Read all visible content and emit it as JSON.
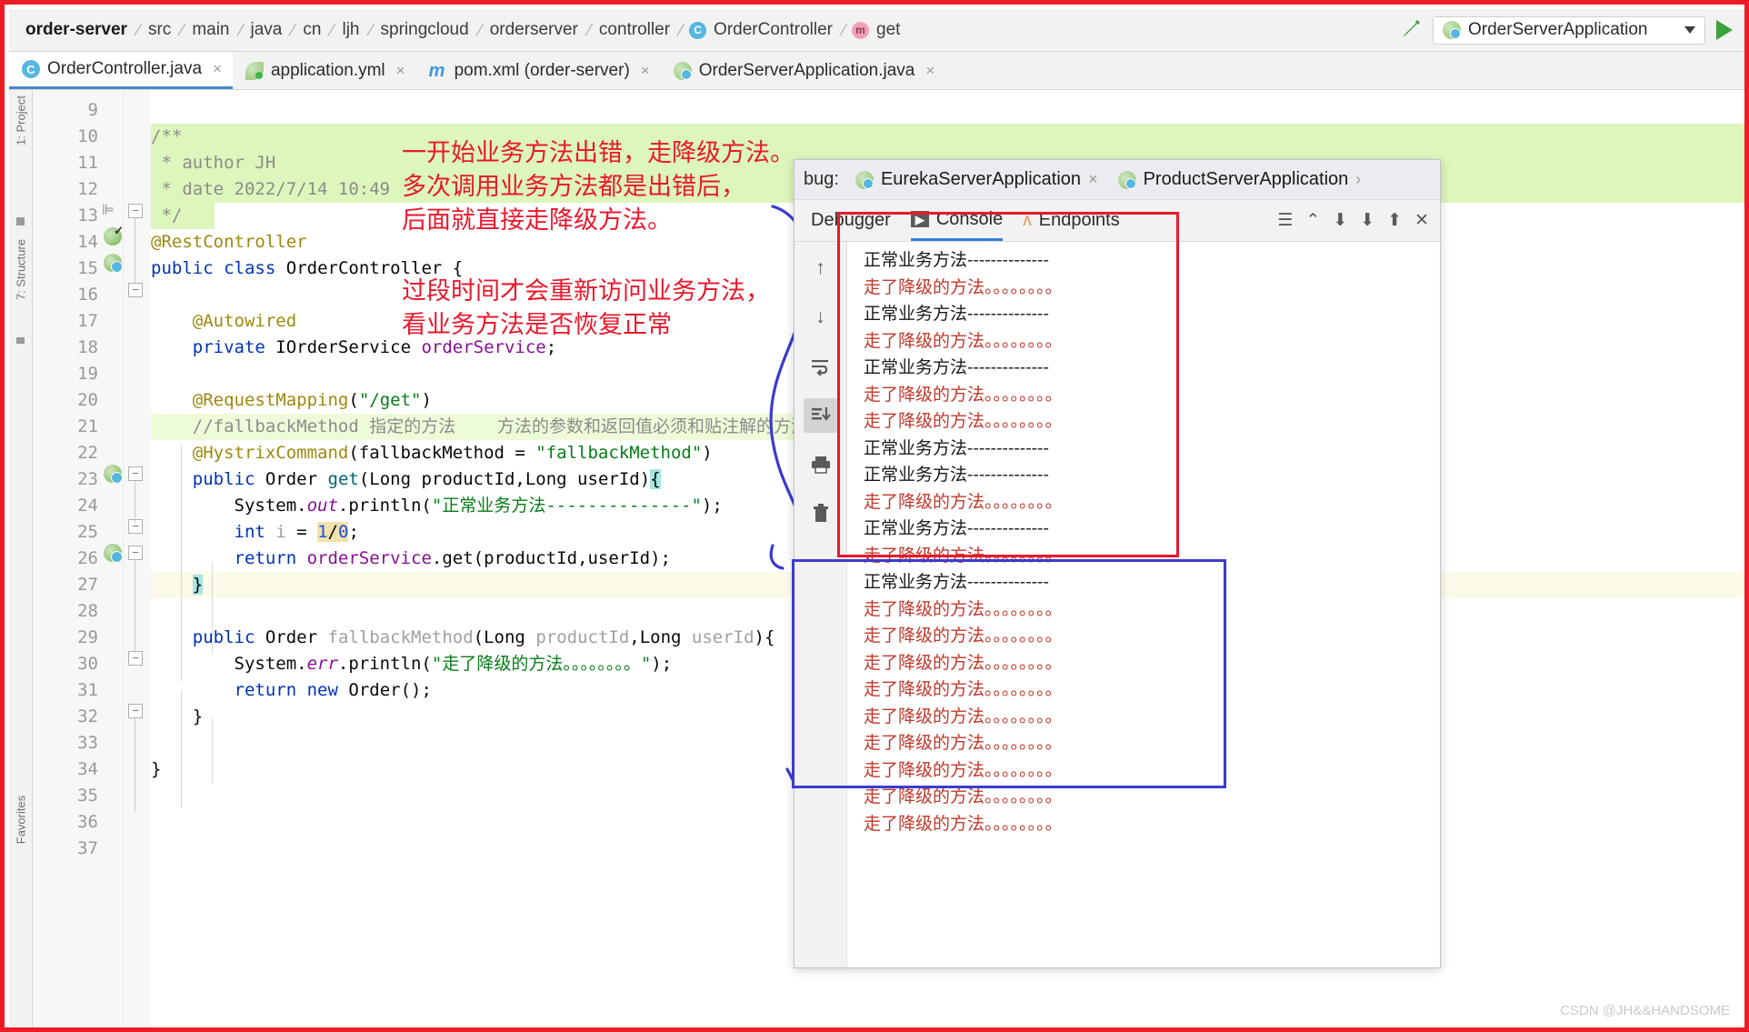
{
  "window": {
    "frame_color": "#ee1c25"
  },
  "breadcrumb": {
    "items": [
      {
        "label": "order-server",
        "bold": true,
        "icon": null
      },
      {
        "label": "src",
        "bold": false,
        "icon": null
      },
      {
        "label": "main",
        "bold": false,
        "icon": null
      },
      {
        "label": "java",
        "bold": false,
        "icon": null
      },
      {
        "label": "cn",
        "bold": false,
        "icon": null
      },
      {
        "label": "ljh",
        "bold": false,
        "icon": null
      },
      {
        "label": "springcloud",
        "bold": false,
        "icon": null
      },
      {
        "label": "orderserver",
        "bold": false,
        "icon": null
      },
      {
        "label": "controller",
        "bold": false,
        "icon": null
      },
      {
        "label": "OrderController",
        "bold": false,
        "icon": "class-badge-c"
      },
      {
        "label": "get",
        "bold": false,
        "icon": "method-badge-m"
      }
    ]
  },
  "toolbar": {
    "hammer_icon": "build-hammer-icon",
    "run_config": "OrderServerApplication",
    "run_config_icon": "springboot-icon",
    "dropdown_icon": "chevron-down-icon",
    "run_icon": "run-play-icon"
  },
  "editor_tabs": [
    {
      "label": "OrderController.java",
      "icon": "java-class-icon",
      "active": true,
      "close": "×"
    },
    {
      "label": "application.yml",
      "icon": "yaml-leaf-icon",
      "active": false,
      "close": "×"
    },
    {
      "label": "pom.xml (order-server)",
      "icon": "maven-m-icon",
      "active": false,
      "close": "×"
    },
    {
      "label": "OrderServerApplication.java",
      "icon": "springboot-icon",
      "active": false,
      "close": "×"
    }
  ],
  "left_rail": {
    "labels": [
      "1: Project",
      "7: Structure",
      "Favorites"
    ]
  },
  "code": {
    "first_line_number": 9,
    "lines": [
      {
        "n": 9,
        "html": "",
        "bg": ""
      },
      {
        "n": 10,
        "html": "<span class='cmt'>/**</span>",
        "bg": "hl-green"
      },
      {
        "n": 11,
        "html": "<span class='cmt'> * author JH</span>",
        "bg": "hl-green"
      },
      {
        "n": 12,
        "html": "<span class='cmt'> * date 2022/7/14 10:49</span>",
        "bg": "hl-green"
      },
      {
        "n": 13,
        "html": "<span class='cmt'> */</span>",
        "bg": "hl-green-partial"
      },
      {
        "n": 14,
        "html": "<span class='anno'>@RestController</span>",
        "bg": ""
      },
      {
        "n": 15,
        "html": "<span class='kw'>public</span> <span class='kw'>class</span> <span class='plain'>OrderController</span> <span class='plain'>{</span>",
        "bg": ""
      },
      {
        "n": 16,
        "html": "",
        "bg": ""
      },
      {
        "n": 17,
        "html": "    <span class='anno'>@Autowired</span>",
        "bg": ""
      },
      {
        "n": 18,
        "html": "    <span class='kw'>private</span> <span class='plain'>IOrderService</span> <span class='fld'>orderService</span><span class='plain'>;</span>",
        "bg": ""
      },
      {
        "n": 19,
        "html": "",
        "bg": ""
      },
      {
        "n": 20,
        "html": "    <span class='anno'>@RequestMapping</span><span class='plain'>(</span><span class='str'>\"/get\"</span><span class='plain'>)</span>",
        "bg": ""
      },
      {
        "n": 21,
        "html": "    <span class='cmt'>//fallbackMethod 指定的方法    方法的参数和返回值必须和贴注解的方法保持一致</span>",
        "bg": "hl-green-soft"
      },
      {
        "n": 22,
        "html": "    <span class='anno'>@HystrixCommand</span><span class='plain'>(fallbackMethod = </span><span class='str'>\"fallbackMethod\"</span><span class='plain'>)</span>",
        "bg": ""
      },
      {
        "n": 23,
        "html": "    <span class='kw'>public</span> <span class='plain'>Order</span> <span class='mth'>get</span><span class='plain'>(Long productId,Long userId)</span><span class='brace-match'>{</span>",
        "bg": ""
      },
      {
        "n": 24,
        "html": "        <span class='plain'>System.</span><span class='stat-italic'>out</span><span class='plain'>.println(</span><span class='str'>\"正常业务方法--------------\"</span><span class='plain'>);</span>",
        "bg": ""
      },
      {
        "n": 25,
        "html": "        <span class='kw'>int</span> <span class='grey'>i</span> <span class='plain'>= </span><span class='warn-hl'><span class='num'>1</span><span class='plain'>/</span><span class='num'>0</span></span><span class='plain'>;</span>",
        "bg": ""
      },
      {
        "n": 26,
        "html": "        <span class='kw'>return</span> <span class='fld'>orderService</span><span class='plain'>.get(productId,userId);</span>",
        "bg": ""
      },
      {
        "n": 27,
        "html": "    <span class='brace-match'>}</span>",
        "bg": "hl-caret"
      },
      {
        "n": 28,
        "html": "",
        "bg": ""
      },
      {
        "n": 29,
        "html": "    <span class='kw'>public</span> <span class='plain'>Order</span> <span class='grey'>fallbackMethod</span><span class='plain'>(Long </span><span class='grey'>productId</span><span class='plain'>,Long </span><span class='grey'>userId</span><span class='plain'>){</span>",
        "bg": ""
      },
      {
        "n": 30,
        "html": "        <span class='plain'>System.</span><span class='stat-italic'>err</span><span class='plain'>.println(</span><span class='str'>\"走了降级的方法。。。。。。。。\"</span><span class='plain'>);</span>",
        "bg": ""
      },
      {
        "n": 31,
        "html": "        <span class='kw'>return</span> <span class='kw'>new</span> <span class='plain'>Order();</span>",
        "bg": ""
      },
      {
        "n": 32,
        "html": "    <span class='plain'>}</span>",
        "bg": ""
      },
      {
        "n": 33,
        "html": "",
        "bg": ""
      },
      {
        "n": 34,
        "html": "<span class='plain'>}</span>",
        "bg": ""
      },
      {
        "n": 35,
        "html": "",
        "bg": ""
      },
      {
        "n": 36,
        "html": "",
        "bg": ""
      },
      {
        "n": 37,
        "html": "",
        "bg": ""
      }
    ]
  },
  "annotations": {
    "color": "#e8192c",
    "block1": [
      "一开始业务方法出错，走降级方法。",
      "多次调用业务方法都是出错后，",
      "后面就直接走降级方法。"
    ],
    "block2": [
      "过段时间才会重新访问业务方法，",
      "看业务方法是否恢复正常"
    ]
  },
  "debug_window": {
    "title": "bug:",
    "app_tabs": [
      {
        "label": "EurekaServerApplication",
        "icon": "springboot-icon",
        "close": "×"
      },
      {
        "label": "ProductServerApplication",
        "icon": "springboot-icon",
        "close": "›"
      }
    ],
    "tabs": [
      {
        "label": "Debugger",
        "icon": null,
        "active": false
      },
      {
        "label": "Console",
        "icon": "console-icon",
        "active": true
      },
      {
        "label": "Endpoints",
        "icon": "endpoints-icon",
        "active": false
      }
    ],
    "tool_icons": [
      "menu-icon",
      "export-icon",
      "download-icon",
      "download-all-icon",
      "upload-icon",
      "close-icon"
    ],
    "side_buttons": [
      {
        "icon": "arrow-up-icon",
        "name": "previous-occurrence",
        "selected": false
      },
      {
        "icon": "arrow-down-icon",
        "name": "next-occurrence",
        "selected": false
      },
      {
        "icon": "soft-wrap-icon",
        "name": "soft-wrap-toggle",
        "selected": false
      },
      {
        "icon": "scroll-to-end-icon",
        "name": "scroll-to-end",
        "selected": true
      },
      {
        "icon": "print-icon",
        "name": "print-output",
        "selected": false
      },
      {
        "icon": "trash-icon",
        "name": "clear-console",
        "selected": false
      }
    ],
    "console_lines": [
      {
        "text": "正常业务方法--------------",
        "stream": "out"
      },
      {
        "text": "走了降级的方法。。。。。。。。",
        "stream": "err"
      },
      {
        "text": "正常业务方法--------------",
        "stream": "out"
      },
      {
        "text": "走了降级的方法。。。。。。。。",
        "stream": "err"
      },
      {
        "text": "正常业务方法--------------",
        "stream": "out"
      },
      {
        "text": "走了降级的方法。。。。。。。。",
        "stream": "err"
      },
      {
        "text": "走了降级的方法。。。。。。。。",
        "stream": "err"
      },
      {
        "text": "正常业务方法--------------",
        "stream": "out"
      },
      {
        "text": "正常业务方法--------------",
        "stream": "out"
      },
      {
        "text": "走了降级的方法。。。。。。。。",
        "stream": "err"
      },
      {
        "text": "正常业务方法--------------",
        "stream": "out"
      },
      {
        "text": "走了降级的方法。。。。。。。。",
        "stream": "err"
      },
      {
        "text": "正常业务方法--------------",
        "stream": "out"
      },
      {
        "text": "走了降级的方法。。。。。。。。",
        "stream": "err"
      },
      {
        "text": "走了降级的方法。。。。。。。。",
        "stream": "err"
      },
      {
        "text": "走了降级的方法。。。。。。。。",
        "stream": "err"
      },
      {
        "text": "走了降级的方法。。。。。。。。",
        "stream": "err"
      },
      {
        "text": "走了降级的方法。。。。。。。。",
        "stream": "err"
      },
      {
        "text": "走了降级的方法。。。。。。。。",
        "stream": "err"
      },
      {
        "text": "走了降级的方法。。。。。。。。",
        "stream": "err"
      },
      {
        "text": "走了降级的方法。。。。。。。。",
        "stream": "err"
      },
      {
        "text": "走了降级的方法。。。。。。。。",
        "stream": "err"
      }
    ]
  },
  "overlay_boxes": {
    "red_box_color": "#e8192c",
    "blue_box_color": "#3b3bd0"
  },
  "watermark": "CSDN @JH&&HANDSOME"
}
